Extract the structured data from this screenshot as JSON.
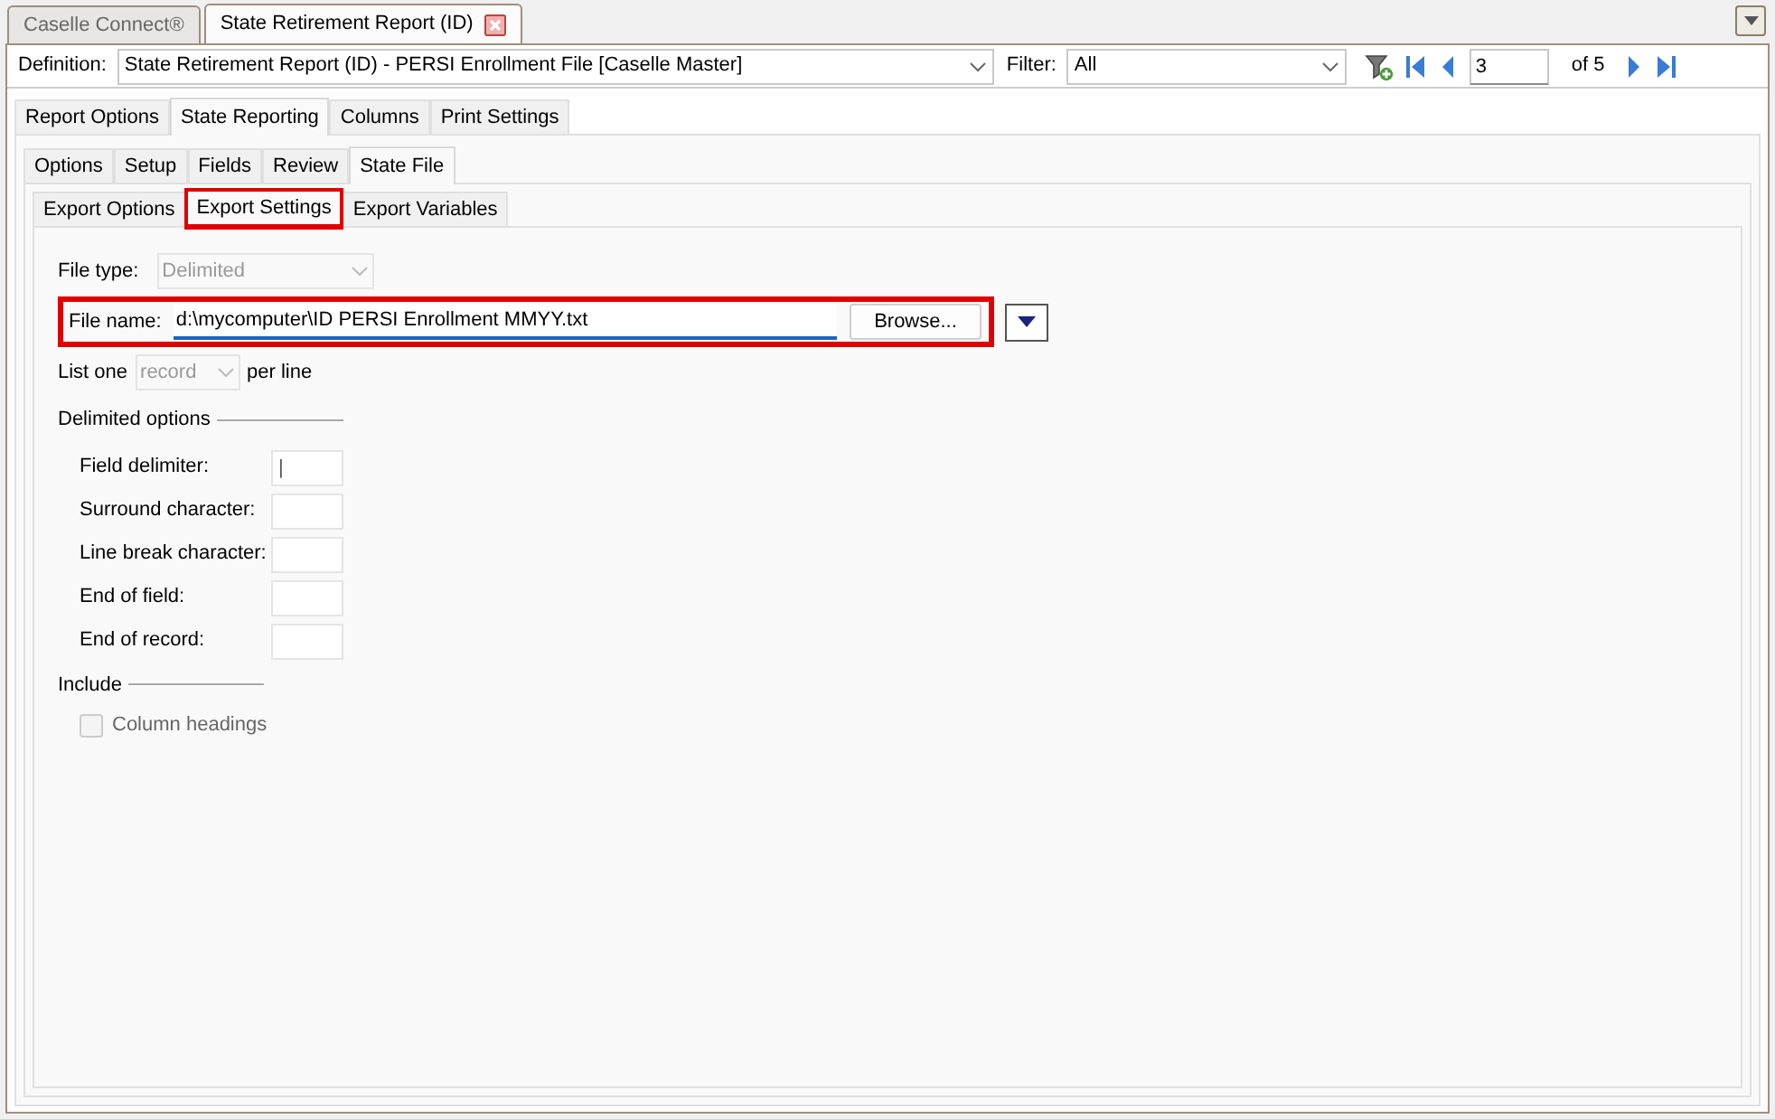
{
  "document_tabs": [
    {
      "label": "Caselle Connect®",
      "selected": false,
      "closable": false
    },
    {
      "label": "State Retirement Report (ID)",
      "selected": true,
      "closable": true
    }
  ],
  "toolbar": {
    "definition_label": "Definition:",
    "definition": "State Retirement Report (ID) - PERSI Enrollment File [Caselle Master]",
    "filter_label": "Filter:",
    "filter": "All",
    "page": "3",
    "page_count": "of 5"
  },
  "report_tabs": [
    {
      "label": "Report Options",
      "selected": false
    },
    {
      "label": "State Reporting",
      "selected": true
    },
    {
      "label": "Columns",
      "selected": false
    },
    {
      "label": "Print Settings",
      "selected": false
    }
  ],
  "section_tabs": [
    {
      "label": "Options",
      "selected": false
    },
    {
      "label": "Setup",
      "selected": false
    },
    {
      "label": "Fields",
      "selected": false
    },
    {
      "label": "Review",
      "selected": false
    },
    {
      "label": "State File",
      "selected": true
    }
  ],
  "export_tabs": [
    {
      "label": "Export Options",
      "selected": false,
      "highlighted": false
    },
    {
      "label": "Export Settings",
      "selected": true,
      "highlighted": true
    },
    {
      "label": "Export Variables",
      "selected": false,
      "highlighted": false
    }
  ],
  "form": {
    "file_type": {
      "label": "File type:",
      "value": "Delimited",
      "disabled": true
    },
    "file_name": {
      "label": "File name:",
      "value": "d:\\mycomputer\\ID PERSI Enrollment MMYY.txt",
      "browse": "Browse...",
      "highlighted": true
    },
    "list_one": {
      "label": "List one",
      "value": "record",
      "suffix": "per line",
      "disabled": true
    },
    "delimited_options": {
      "title": "Delimited options",
      "fields": [
        {
          "label": "Field delimiter:",
          "value": "|"
        },
        {
          "label": "Surround character:"
        },
        {
          "label": "Line break character:"
        },
        {
          "label": "End of field:"
        },
        {
          "label": "End of record:"
        }
      ]
    },
    "include": {
      "title": "Include",
      "checkboxes": [
        {
          "label": "Column headings",
          "checked": false,
          "disabled": true
        }
      ]
    }
  }
}
